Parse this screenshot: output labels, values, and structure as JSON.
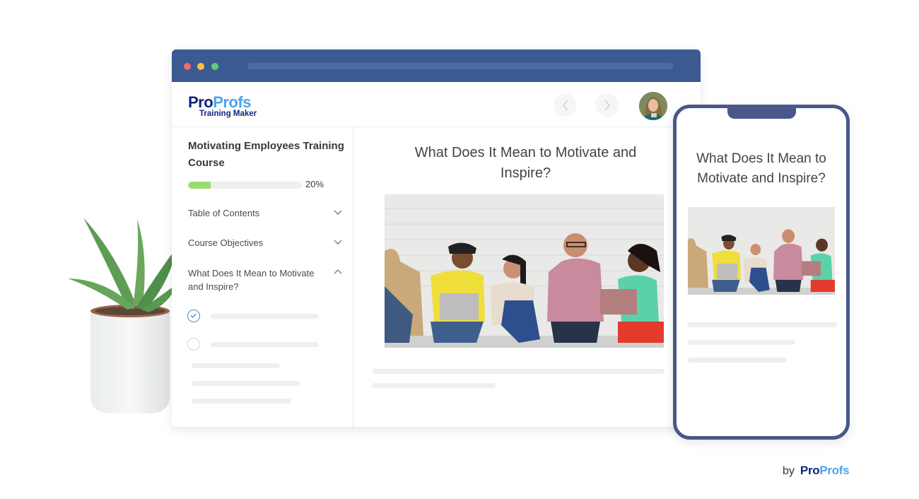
{
  "browser": {
    "window_controls": [
      "close",
      "minimize",
      "maximize"
    ],
    "logo": {
      "primary": "Pro",
      "secondary": "Profs",
      "subtitle": "Training Maker"
    },
    "nav": {
      "prev_icon": "chevron-left-icon",
      "next_icon": "chevron-right-icon"
    },
    "user_avatar": "user-avatar"
  },
  "sidebar": {
    "course_title": "Motivating Employees Training Course",
    "progress": {
      "percent": 20,
      "label": "20%"
    },
    "items": [
      {
        "label": "Table of Contents",
        "expanded": false
      },
      {
        "label": "Course Objectives",
        "expanded": false
      },
      {
        "label": "What Does It Mean to Motivate and Inspire?",
        "expanded": true
      }
    ],
    "subitems": [
      {
        "status": "completed"
      },
      {
        "status": "incomplete"
      }
    ]
  },
  "main": {
    "title": "What Does It Mean to Motivate and Inspire?",
    "image_alt": "Group of diverse colleagues sitting against a white brick wall laughing with laptops"
  },
  "phone": {
    "title": "What Does It Mean to Motivate and Inspire?",
    "image_alt": "Group of diverse colleagues sitting against a white brick wall"
  },
  "footer": {
    "by_label": "by",
    "brand_primary": "Pro",
    "brand_secondary": "Profs"
  },
  "colors": {
    "titlebar": "#3c5a92",
    "phone_frame": "#4a578b",
    "progress_fill": "#9add6c",
    "brand_dark": "#10257a",
    "brand_light": "#4aa3f0"
  }
}
